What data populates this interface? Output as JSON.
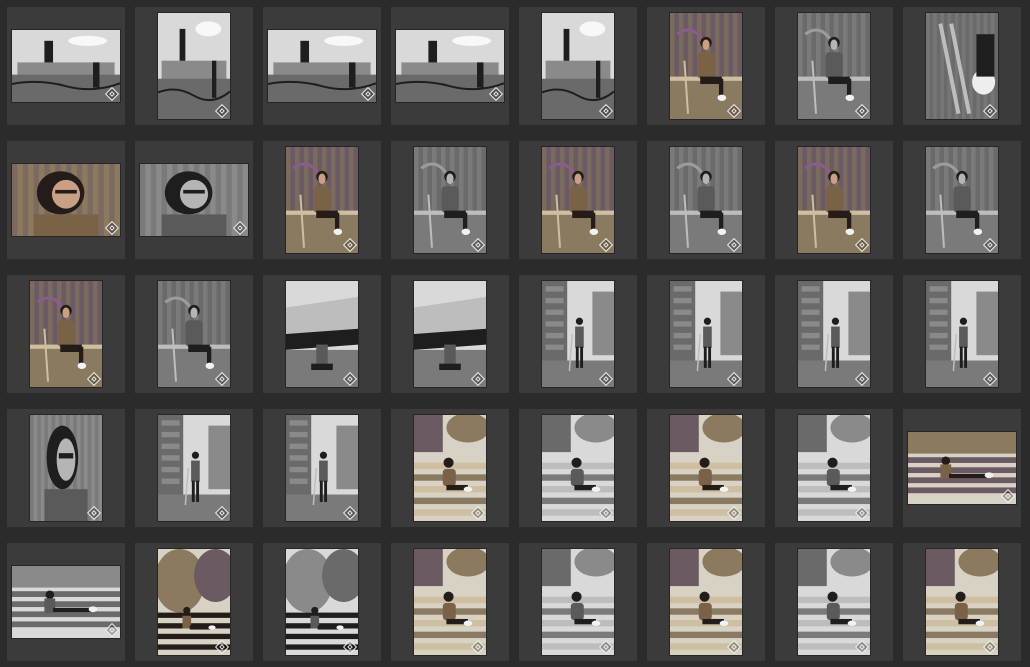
{
  "grid": {
    "columns": 8,
    "rows": 5,
    "thumbnails": [
      {
        "orientation": "landscape",
        "tone": "bw",
        "subject": "skyline"
      },
      {
        "orientation": "portrait",
        "tone": "bw",
        "subject": "skyline"
      },
      {
        "orientation": "landscape",
        "tone": "bw",
        "subject": "skyline"
      },
      {
        "orientation": "landscape",
        "tone": "bw",
        "subject": "skyline"
      },
      {
        "orientation": "portrait",
        "tone": "bw",
        "subject": "skyline"
      },
      {
        "orientation": "portrait",
        "tone": "color",
        "subject": "graffiti-sitting"
      },
      {
        "orientation": "portrait",
        "tone": "bw",
        "subject": "graffiti-sitting"
      },
      {
        "orientation": "portrait",
        "tone": "bw",
        "subject": "crutches-closeup"
      },
      {
        "orientation": "landscape",
        "tone": "color",
        "subject": "portrait-closeup"
      },
      {
        "orientation": "landscape",
        "tone": "bw",
        "subject": "portrait-closeup"
      },
      {
        "orientation": "portrait",
        "tone": "color",
        "subject": "graffiti-sitting"
      },
      {
        "orientation": "portrait",
        "tone": "bw",
        "subject": "graffiti-sitting"
      },
      {
        "orientation": "portrait",
        "tone": "color",
        "subject": "graffiti-sitting"
      },
      {
        "orientation": "portrait",
        "tone": "bw",
        "subject": "graffiti-sitting"
      },
      {
        "orientation": "portrait",
        "tone": "color",
        "subject": "graffiti-sitting"
      },
      {
        "orientation": "portrait",
        "tone": "bw",
        "subject": "graffiti-sitting"
      },
      {
        "orientation": "portrait",
        "tone": "color",
        "subject": "graffiti-sitting"
      },
      {
        "orientation": "portrait",
        "tone": "bw",
        "subject": "graffiti-sitting"
      },
      {
        "orientation": "portrait",
        "tone": "bw",
        "subject": "harbor"
      },
      {
        "orientation": "portrait",
        "tone": "bw",
        "subject": "harbor"
      },
      {
        "orientation": "portrait",
        "tone": "bw",
        "subject": "street-standing"
      },
      {
        "orientation": "portrait",
        "tone": "bw",
        "subject": "street-standing"
      },
      {
        "orientation": "portrait",
        "tone": "bw",
        "subject": "street-standing"
      },
      {
        "orientation": "portrait",
        "tone": "bw",
        "subject": "street-standing"
      },
      {
        "orientation": "portrait",
        "tone": "bw",
        "subject": "portrait-closeup"
      },
      {
        "orientation": "portrait",
        "tone": "bw",
        "subject": "street-standing"
      },
      {
        "orientation": "portrait",
        "tone": "bw",
        "subject": "street-standing"
      },
      {
        "orientation": "portrait",
        "tone": "color",
        "subject": "steps-sitting"
      },
      {
        "orientation": "portrait",
        "tone": "bw",
        "subject": "steps-sitting"
      },
      {
        "orientation": "portrait",
        "tone": "color",
        "subject": "steps-sitting"
      },
      {
        "orientation": "portrait",
        "tone": "bw",
        "subject": "steps-sitting"
      },
      {
        "orientation": "landscape",
        "tone": "color",
        "subject": "bench"
      },
      {
        "orientation": "landscape",
        "tone": "bw",
        "subject": "bench"
      },
      {
        "orientation": "portrait",
        "tone": "color",
        "subject": "park-bench"
      },
      {
        "orientation": "portrait",
        "tone": "bw",
        "subject": "park-bench"
      },
      {
        "orientation": "portrait",
        "tone": "color",
        "subject": "steps-sitting"
      },
      {
        "orientation": "portrait",
        "tone": "bw",
        "subject": "steps-sitting"
      },
      {
        "orientation": "portrait",
        "tone": "color",
        "subject": "steps-sitting"
      },
      {
        "orientation": "portrait",
        "tone": "bw",
        "subject": "steps-sitting"
      },
      {
        "orientation": "portrait",
        "tone": "color",
        "subject": "steps-sitting"
      }
    ]
  },
  "colors": {
    "background": "#2b2b2b",
    "cell": "#3b3b3b"
  }
}
